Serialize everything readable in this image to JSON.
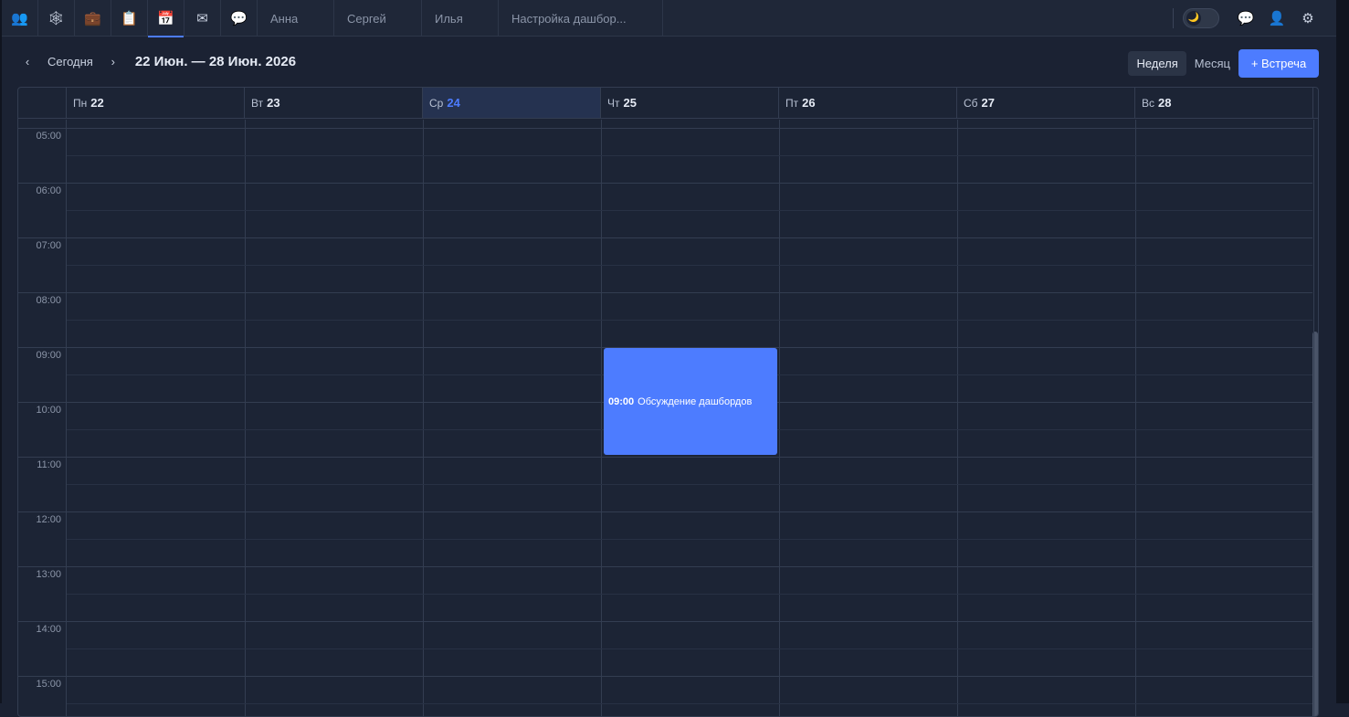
{
  "topbar": {
    "icon_tabs": [
      {
        "name": "contacts-icon",
        "glyph": "👥"
      },
      {
        "name": "network-icon",
        "glyph": "🕸"
      },
      {
        "name": "briefcase-icon",
        "glyph": "💼"
      },
      {
        "name": "clipboard-icon",
        "glyph": "📋"
      },
      {
        "name": "calendar-icon",
        "glyph": "📅"
      },
      {
        "name": "mail-icon",
        "glyph": "✉"
      },
      {
        "name": "chat-bubble-icon",
        "glyph": "💬"
      }
    ],
    "name_tabs": [
      "Анна",
      "Сергей",
      "Илья",
      "Настройка дашбор..."
    ],
    "right_icons": {
      "moon": "🌙",
      "messages": "💬",
      "profile": "👤",
      "settings": "⚙"
    }
  },
  "toolbar": {
    "prev": "‹",
    "today": "Сегодня",
    "next": "›",
    "range": "22 Июн. — 28 Июн. 2026",
    "view_week": "Неделя",
    "view_month": "Месяц",
    "add": "+ Встреча"
  },
  "calendar": {
    "days": [
      {
        "dow": "Пн",
        "num": "22"
      },
      {
        "dow": "Вт",
        "num": "23"
      },
      {
        "dow": "Ср",
        "num": "24"
      },
      {
        "dow": "Чт",
        "num": "25"
      },
      {
        "dow": "Пт",
        "num": "26"
      },
      {
        "dow": "Сб",
        "num": "27"
      },
      {
        "dow": "Вс",
        "num": "28"
      }
    ],
    "today_index": 2,
    "hours": [
      "05:00",
      "06:00",
      "07:00",
      "08:00",
      "09:00",
      "10:00",
      "11:00",
      "12:00",
      "13:00",
      "14:00",
      "15:00"
    ],
    "events": [
      {
        "day_index": 3,
        "start": "09:00",
        "end": "11:00",
        "time": "09:00",
        "title": "Обсуждение дашбордов"
      }
    ]
  },
  "colors": {
    "accent": "#4d7cff",
    "background": "#1b2233"
  }
}
